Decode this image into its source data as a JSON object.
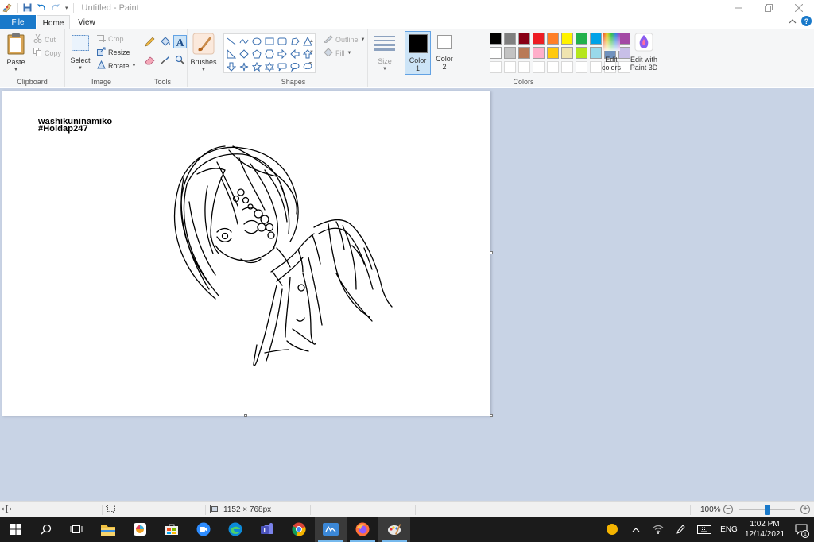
{
  "window": {
    "title": "Untitled - Paint"
  },
  "tabs": {
    "file": "File",
    "home": "Home",
    "view": "View"
  },
  "ribbon": {
    "clipboard": {
      "group_label": "Clipboard",
      "paste": "Paste",
      "cut": "Cut",
      "copy": "Copy"
    },
    "image": {
      "group_label": "Image",
      "select": "Select",
      "crop": "Crop",
      "resize": "Resize",
      "rotate": "Rotate"
    },
    "tools": {
      "group_label": "Tools"
    },
    "brushes": {
      "label": "Brushes"
    },
    "shapes": {
      "group_label": "Shapes",
      "outline": "Outline",
      "fill": "Fill"
    },
    "size": {
      "label": "Size"
    },
    "colors": {
      "group_label": "Colors",
      "color1_line1": "Color",
      "color1_line2": "1",
      "color2_line1": "Color",
      "color2_line2": "2",
      "color1_value": "#000000",
      "color2_value": "#ffffff",
      "edit_colors_line1": "Edit",
      "edit_colors_line2": "colors",
      "edit_paint3d_line1": "Edit with",
      "edit_paint3d_line2": "Paint 3D",
      "palette_row1": [
        "#000000",
        "#7f7f7f",
        "#880015",
        "#ed1c24",
        "#ff7f27",
        "#fff200",
        "#22b14c",
        "#00a2e8",
        "#3f48cc",
        "#a349a4"
      ],
      "palette_row2": [
        "#ffffff",
        "#c3c3c3",
        "#b97a57",
        "#ffaec9",
        "#ffc90e",
        "#efe4b0",
        "#b5e61d",
        "#99d9ea",
        "#7092be",
        "#c8bfe7"
      ]
    }
  },
  "canvas": {
    "line1": "washikuninamiko",
    "line2": "#Hoidap247"
  },
  "status": {
    "image_size": "1152 × 768px",
    "zoom": "100%",
    "zoom_fraction": 0.5
  },
  "taskbar": {
    "language": "ENG",
    "time": "1:02 PM",
    "date": "12/14/2021",
    "notification_count": "1"
  }
}
